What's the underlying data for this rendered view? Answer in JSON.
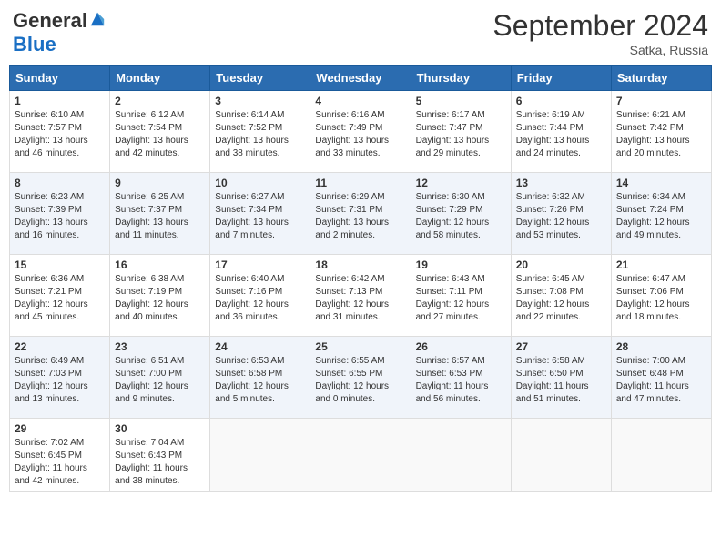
{
  "header": {
    "logo_general": "General",
    "logo_blue": "Blue",
    "month_year": "September 2024",
    "location": "Satka, Russia"
  },
  "weekdays": [
    "Sunday",
    "Monday",
    "Tuesday",
    "Wednesday",
    "Thursday",
    "Friday",
    "Saturday"
  ],
  "weeks": [
    [
      {
        "day": "1",
        "info": "Sunrise: 6:10 AM\nSunset: 7:57 PM\nDaylight: 13 hours\nand 46 minutes."
      },
      {
        "day": "2",
        "info": "Sunrise: 6:12 AM\nSunset: 7:54 PM\nDaylight: 13 hours\nand 42 minutes."
      },
      {
        "day": "3",
        "info": "Sunrise: 6:14 AM\nSunset: 7:52 PM\nDaylight: 13 hours\nand 38 minutes."
      },
      {
        "day": "4",
        "info": "Sunrise: 6:16 AM\nSunset: 7:49 PM\nDaylight: 13 hours\nand 33 minutes."
      },
      {
        "day": "5",
        "info": "Sunrise: 6:17 AM\nSunset: 7:47 PM\nDaylight: 13 hours\nand 29 minutes."
      },
      {
        "day": "6",
        "info": "Sunrise: 6:19 AM\nSunset: 7:44 PM\nDaylight: 13 hours\nand 24 minutes."
      },
      {
        "day": "7",
        "info": "Sunrise: 6:21 AM\nSunset: 7:42 PM\nDaylight: 13 hours\nand 20 minutes."
      }
    ],
    [
      {
        "day": "8",
        "info": "Sunrise: 6:23 AM\nSunset: 7:39 PM\nDaylight: 13 hours\nand 16 minutes."
      },
      {
        "day": "9",
        "info": "Sunrise: 6:25 AM\nSunset: 7:37 PM\nDaylight: 13 hours\nand 11 minutes."
      },
      {
        "day": "10",
        "info": "Sunrise: 6:27 AM\nSunset: 7:34 PM\nDaylight: 13 hours\nand 7 minutes."
      },
      {
        "day": "11",
        "info": "Sunrise: 6:29 AM\nSunset: 7:31 PM\nDaylight: 13 hours\nand 2 minutes."
      },
      {
        "day": "12",
        "info": "Sunrise: 6:30 AM\nSunset: 7:29 PM\nDaylight: 12 hours\nand 58 minutes."
      },
      {
        "day": "13",
        "info": "Sunrise: 6:32 AM\nSunset: 7:26 PM\nDaylight: 12 hours\nand 53 minutes."
      },
      {
        "day": "14",
        "info": "Sunrise: 6:34 AM\nSunset: 7:24 PM\nDaylight: 12 hours\nand 49 minutes."
      }
    ],
    [
      {
        "day": "15",
        "info": "Sunrise: 6:36 AM\nSunset: 7:21 PM\nDaylight: 12 hours\nand 45 minutes."
      },
      {
        "day": "16",
        "info": "Sunrise: 6:38 AM\nSunset: 7:19 PM\nDaylight: 12 hours\nand 40 minutes."
      },
      {
        "day": "17",
        "info": "Sunrise: 6:40 AM\nSunset: 7:16 PM\nDaylight: 12 hours\nand 36 minutes."
      },
      {
        "day": "18",
        "info": "Sunrise: 6:42 AM\nSunset: 7:13 PM\nDaylight: 12 hours\nand 31 minutes."
      },
      {
        "day": "19",
        "info": "Sunrise: 6:43 AM\nSunset: 7:11 PM\nDaylight: 12 hours\nand 27 minutes."
      },
      {
        "day": "20",
        "info": "Sunrise: 6:45 AM\nSunset: 7:08 PM\nDaylight: 12 hours\nand 22 minutes."
      },
      {
        "day": "21",
        "info": "Sunrise: 6:47 AM\nSunset: 7:06 PM\nDaylight: 12 hours\nand 18 minutes."
      }
    ],
    [
      {
        "day": "22",
        "info": "Sunrise: 6:49 AM\nSunset: 7:03 PM\nDaylight: 12 hours\nand 13 minutes."
      },
      {
        "day": "23",
        "info": "Sunrise: 6:51 AM\nSunset: 7:00 PM\nDaylight: 12 hours\nand 9 minutes."
      },
      {
        "day": "24",
        "info": "Sunrise: 6:53 AM\nSunset: 6:58 PM\nDaylight: 12 hours\nand 5 minutes."
      },
      {
        "day": "25",
        "info": "Sunrise: 6:55 AM\nSunset: 6:55 PM\nDaylight: 12 hours\nand 0 minutes."
      },
      {
        "day": "26",
        "info": "Sunrise: 6:57 AM\nSunset: 6:53 PM\nDaylight: 11 hours\nand 56 minutes."
      },
      {
        "day": "27",
        "info": "Sunrise: 6:58 AM\nSunset: 6:50 PM\nDaylight: 11 hours\nand 51 minutes."
      },
      {
        "day": "28",
        "info": "Sunrise: 7:00 AM\nSunset: 6:48 PM\nDaylight: 11 hours\nand 47 minutes."
      }
    ],
    [
      {
        "day": "29",
        "info": "Sunrise: 7:02 AM\nSunset: 6:45 PM\nDaylight: 11 hours\nand 42 minutes."
      },
      {
        "day": "30",
        "info": "Sunrise: 7:04 AM\nSunset: 6:43 PM\nDaylight: 11 hours\nand 38 minutes."
      },
      null,
      null,
      null,
      null,
      null
    ]
  ]
}
